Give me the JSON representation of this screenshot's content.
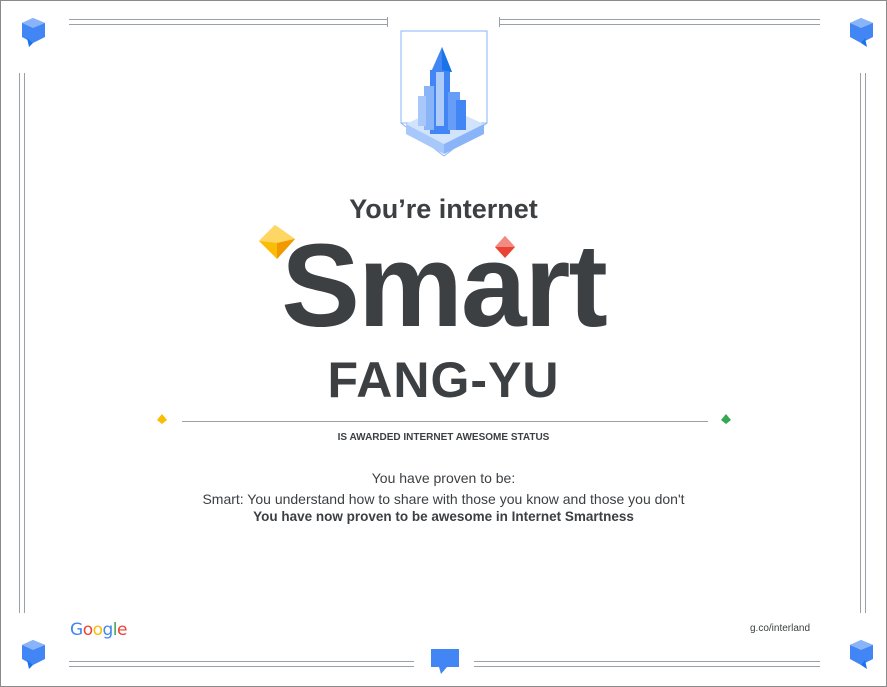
{
  "certificate": {
    "heading": "You’re internet",
    "big_word": "Smart",
    "recipient": "FANG-YU",
    "awarded_text": "IS AWARDED INTERNET AWESOME STATUS",
    "proven_label": "You have proven to be:",
    "description": "Smart: You understand how to share with those you know and those you don't",
    "summary": "You have now proven to be awesome in Internet Smartness"
  },
  "footer": {
    "brand": "Google",
    "url": "g.co/interland",
    "brand_colors": [
      "#4285F4",
      "#EA4335",
      "#FBBC05",
      "#4285F4",
      "#34A853",
      "#EA4335"
    ]
  },
  "colors": {
    "text": "#3c4043",
    "accent_blue": "#4285F4",
    "gem_yellow": "#FBBC05",
    "gem_red": "#EA4335",
    "gem_green": "#34A853"
  }
}
